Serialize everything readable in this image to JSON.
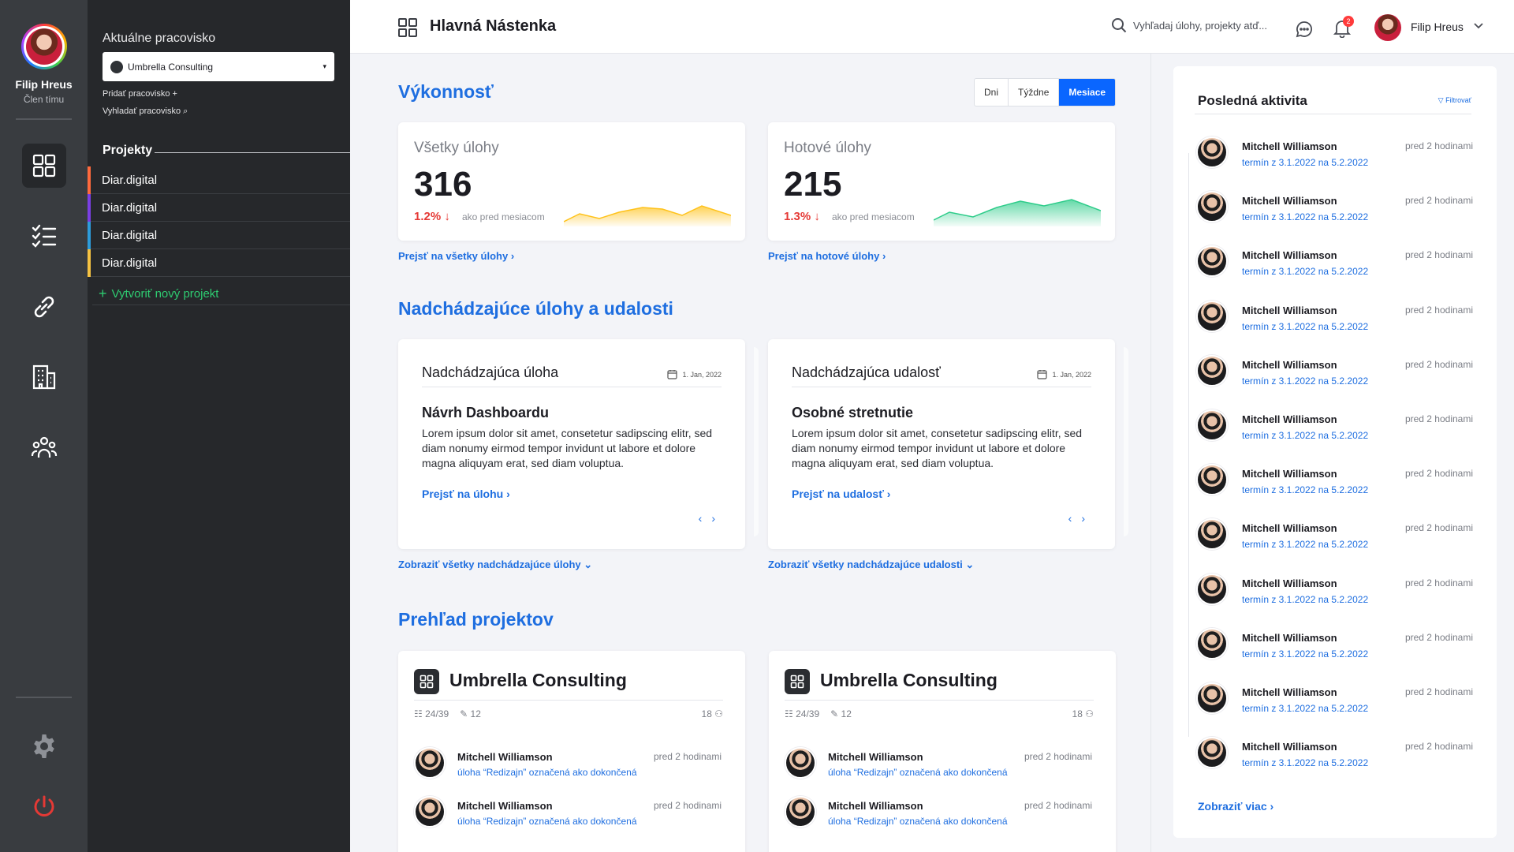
{
  "user": {
    "name": "Filip Hreus",
    "role": "Člen tímu"
  },
  "workspace": {
    "label": "Aktuálne pracovisko",
    "selected": "Umbrella Consulting",
    "add": "Pridať pracovisko +",
    "find": "Vyhladať pracovisko"
  },
  "projects": {
    "heading": "Projekty",
    "items": [
      {
        "label": "Diar.digital",
        "color": "#ff6a3d"
      },
      {
        "label": "Diar.digital",
        "color": "#7b3fe4"
      },
      {
        "label": "Diar.digital",
        "color": "#2d9cdb"
      },
      {
        "label": "Diar.digital",
        "color": "#f5c242"
      }
    ],
    "create": "Vytvoriť nový projekt"
  },
  "header": {
    "title": "Hlavná Nástenka",
    "search_placeholder": "Vyhľadaj úlohy, projekty atď...",
    "notifications": "2",
    "user_name": "Filip Hreus"
  },
  "performance": {
    "title": "Výkonnosť",
    "tabs": [
      "Dni",
      "Týždne",
      "Mesiace"
    ],
    "active_tab": "Mesiace",
    "cards": [
      {
        "label": "Všetky úlohy",
        "value": "316",
        "change": "1.2%",
        "compare": "ako pred mesiacom",
        "link": "Prejsť na všetky úlohy",
        "color": "#ffc21a"
      },
      {
        "label": "Hotové úlohy",
        "value": "215",
        "change": "1.3%",
        "compare": "ako pred mesiacom",
        "link": "Prejsť na hotové úlohy",
        "color": "#2ecc8a"
      }
    ]
  },
  "upcoming": {
    "title": "Nadchádzajúce úlohy a udalosti",
    "cards": [
      {
        "head": "Nadchádzajúca úloha",
        "date": "1. Jan, 2022",
        "title": "Návrh Dashboardu",
        "body": "Lorem ipsum dolor sit amet, consetetur sadipscing elitr, sed diam nonumy eirmod tempor invidunt ut labore et dolore magna aliquyam erat, sed diam voluptua.",
        "link": "Prejsť na úlohu",
        "more": "Zobraziť všetky nadchádzajúce úlohy"
      },
      {
        "head": "Nadchádzajúca udalosť",
        "date": "1. Jan, 2022",
        "title": "Osobné stretnutie",
        "body": "Lorem ipsum dolor sit amet, consetetur sadipscing elitr, sed diam nonumy eirmod tempor invidunt ut labore et dolore magna aliquyam erat, sed diam voluptua.",
        "link": "Prejsť na udalosť",
        "more": "Zobraziť všetky nadchádzajúce udalosti"
      }
    ]
  },
  "overview": {
    "title": "Prehľad projektov",
    "cards": [
      {
        "name": "Umbrella Consulting",
        "tasks": "24/39",
        "comments": "12",
        "members": "18",
        "rows": [
          {
            "name": "Mitchell Williamson",
            "desc": "úloha “Redizajn” označená ako dokončená",
            "time": "pred 2 hodinami"
          },
          {
            "name": "Mitchell Williamson",
            "desc": "úloha “Redizajn” označená ako dokončená",
            "time": "pred 2 hodinami"
          }
        ]
      },
      {
        "name": "Umbrella Consulting",
        "tasks": "24/39",
        "comments": "12",
        "members": "18",
        "rows": [
          {
            "name": "Mitchell Williamson",
            "desc": "úloha “Redizajn” označená ako dokončená",
            "time": "pred 2 hodinami"
          },
          {
            "name": "Mitchell Williamson",
            "desc": "úloha “Redizajn” označená ako dokončená",
            "time": "pred 2 hodinami"
          }
        ]
      }
    ]
  },
  "activity": {
    "title": "Posledná aktivita",
    "filter": "Filtrovať",
    "more": "Zobraziť viac",
    "items": [
      {
        "name": "Mitchell Williamson",
        "desc": "termín z 3.1.2022 na 5.2.2022",
        "time": "pred 2 hodinami"
      },
      {
        "name": "Mitchell Williamson",
        "desc": "termín z 3.1.2022 na 5.2.2022",
        "time": "pred 2 hodinami"
      },
      {
        "name": "Mitchell Williamson",
        "desc": "termín z 3.1.2022 na 5.2.2022",
        "time": "pred 2 hodinami"
      },
      {
        "name": "Mitchell Williamson",
        "desc": "termín z 3.1.2022 na 5.2.2022",
        "time": "pred 2 hodinami"
      },
      {
        "name": "Mitchell Williamson",
        "desc": "termín z 3.1.2022 na 5.2.2022",
        "time": "pred 2 hodinami"
      },
      {
        "name": "Mitchell Williamson",
        "desc": "termín z 3.1.2022 na 5.2.2022",
        "time": "pred 2 hodinami"
      },
      {
        "name": "Mitchell Williamson",
        "desc": "termín z 3.1.2022 na 5.2.2022",
        "time": "pred 2 hodinami"
      },
      {
        "name": "Mitchell Williamson",
        "desc": "termín z 3.1.2022 na 5.2.2022",
        "time": "pred 2 hodinami"
      },
      {
        "name": "Mitchell Williamson",
        "desc": "termín z 3.1.2022 na 5.2.2022",
        "time": "pred 2 hodinami"
      },
      {
        "name": "Mitchell Williamson",
        "desc": "termín z 3.1.2022 na 5.2.2022",
        "time": "pred 2 hodinami"
      },
      {
        "name": "Mitchell Williamson",
        "desc": "termín z 3.1.2022 na 5.2.2022",
        "time": "pred 2 hodinami"
      },
      {
        "name": "Mitchell Williamson",
        "desc": "termín z 3.1.2022 na 5.2.2022",
        "time": "pred 2 hodinami"
      }
    ]
  }
}
